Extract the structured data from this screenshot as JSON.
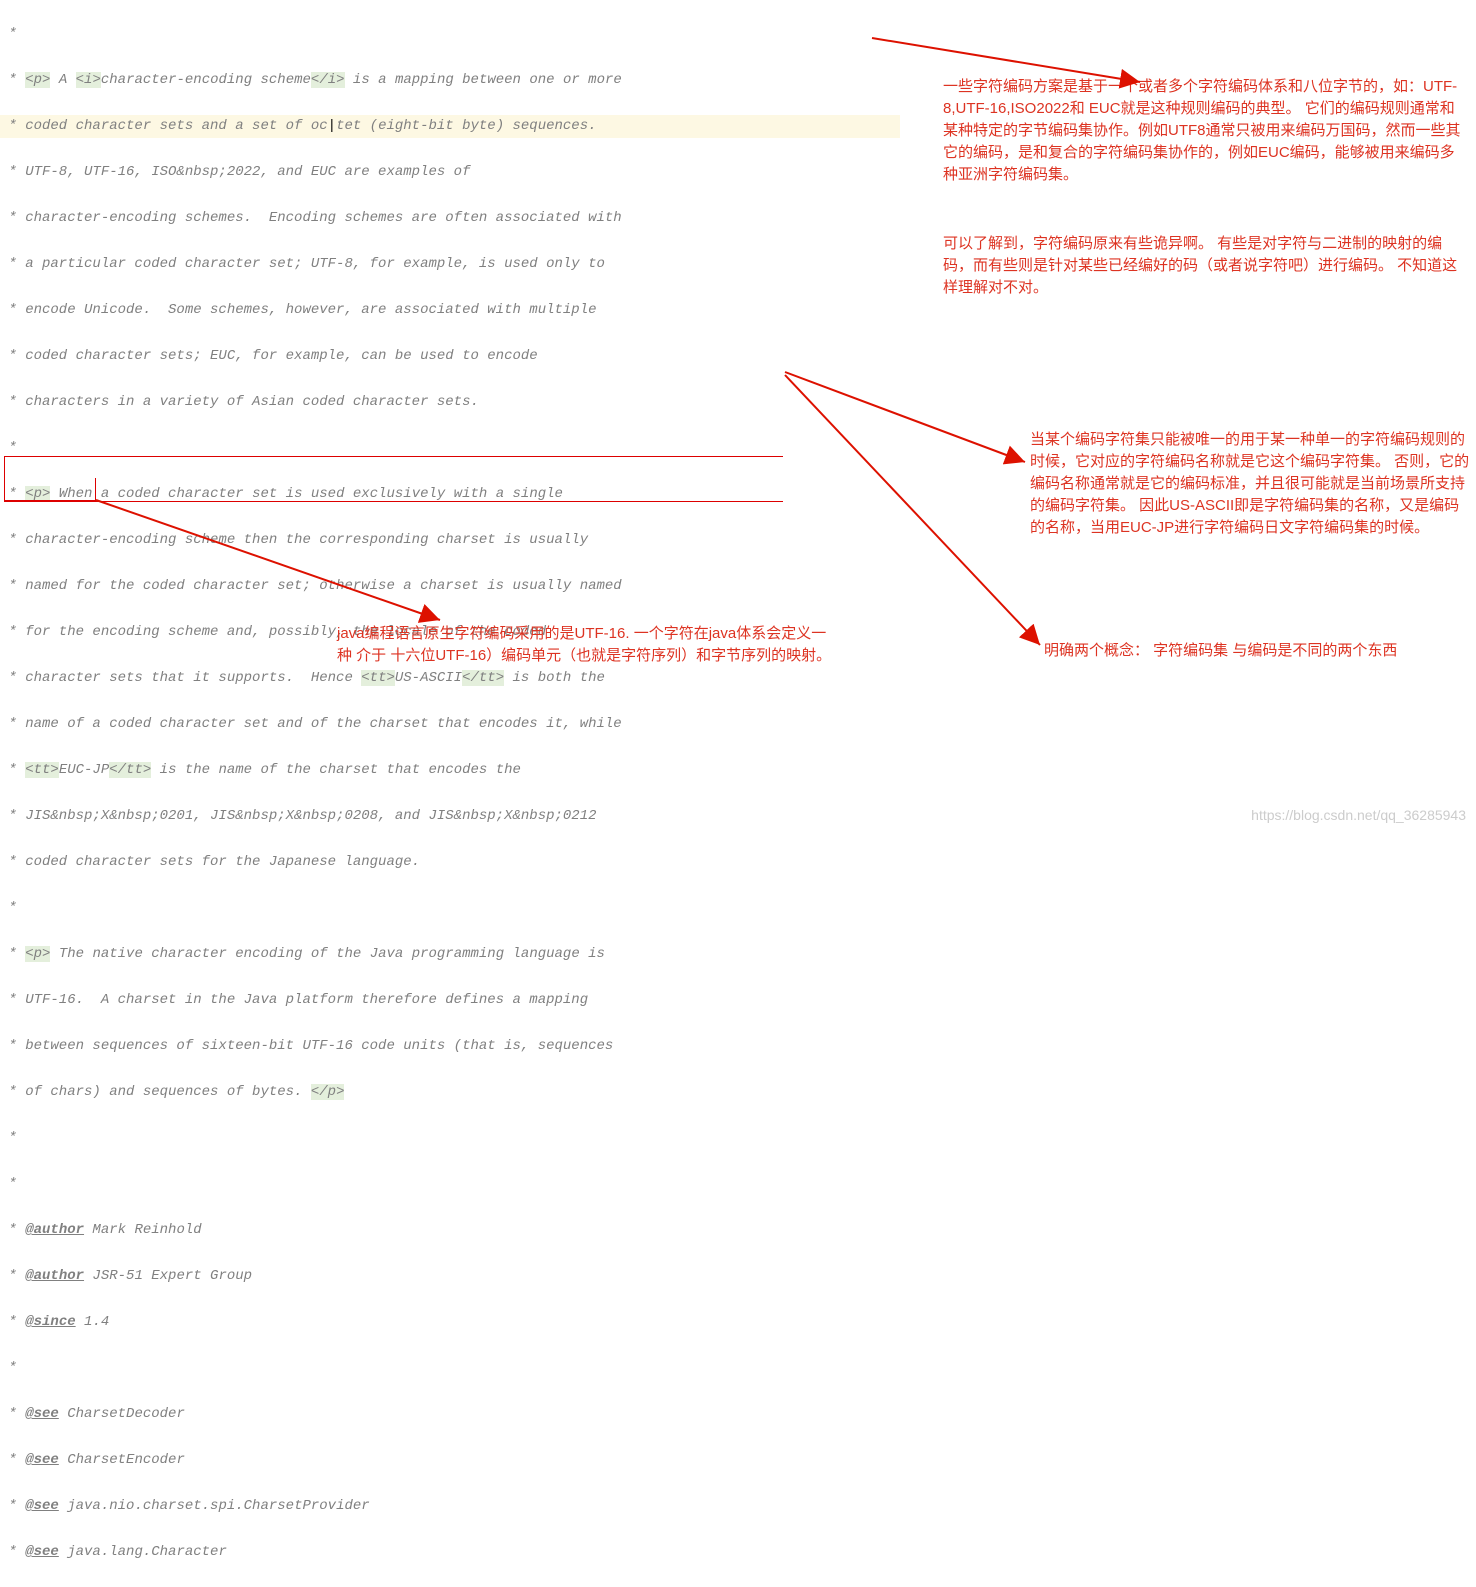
{
  "code": {
    "l0a": " *",
    "l1": " * <p> A <i>character-encoding scheme</i> is a mapping between one or more",
    "l1_pre": " * ",
    "l1_p": "<p>",
    "l1_mid1": " A ",
    "l1_i1": "<i>",
    "l1_mid2": "character-encoding scheme",
    "l1_i2": "</i>",
    "l1_post": " is a mapping between one or more",
    "l2_pre": " * coded character sets and a set of oc",
    "l2_cur": "|",
    "l2_post": "tet (eight-bit byte) sequences.",
    "l3": " * UTF-8, UTF-16, ISO&nbsp;2022, and EUC are examples of",
    "l4": " * character-encoding schemes.  Encoding schemes are often associated with",
    "l5": " * a particular coded character set; UTF-8, for example, is used only to",
    "l6": " * encode Unicode.  Some schemes, however, are associated with multiple",
    "l7": " * coded character sets; EUC, for example, can be used to encode",
    "l8": " * characters in a variety of Asian coded character sets.",
    "l9": " *",
    "l10_pre": " * ",
    "l10_p": "<p>",
    "l10_post": " When a coded character set is used exclusively with a single",
    "l11": " * character-encoding scheme then the corresponding charset is usually",
    "l12": " * named for the coded character set; otherwise a charset is usually named",
    "l13": " * for the encoding scheme and, possibly, the locale of the coded",
    "l14_pre": " * character sets that it supports.  Hence ",
    "l14_tt1": "<tt>",
    "l14_mid": "US-ASCII",
    "l14_tt2": "</tt>",
    "l14_post": " is both the",
    "l15": " * name of a coded character set and of the charset that encodes it, while",
    "l16_pre": " * ",
    "l16_tt1": "<tt>",
    "l16_mid": "EUC-JP",
    "l16_tt2": "</tt>",
    "l16_post": " is the name of the charset that encodes the",
    "l17": " * JIS&nbsp;X&nbsp;0201, JIS&nbsp;X&nbsp;0208, and JIS&nbsp;X&nbsp;0212",
    "l18": " * coded character sets for the Japanese language.",
    "l19": " *",
    "l20_pre": " * ",
    "l20_p": "<p>",
    "l20_post": " The native character encoding of the Java programming language is",
    "l21": " * UTF-16.  A charset in the Java platform therefore defines a mapping",
    "l22": " * between sequences of sixteen-bit UTF-16 code units (that is, sequences",
    "l23_pre": " * of chars) and sequences of bytes. ",
    "l23_p": "</p>",
    "l24": " *",
    "l25": " *",
    "l26_pre": " * ",
    "l26_tag": "@author",
    "l26_post": " Mark Reinhold",
    "l27_pre": " * ",
    "l27_tag": "@author",
    "l27_post": " JSR-51 Expert Group",
    "l28_pre": " * ",
    "l28_tag": "@since",
    "l28_post": " 1.4",
    "l29": " *",
    "l30_pre": " * ",
    "l30_tag": "@see",
    "l30_post": " CharsetDecoder",
    "l31_pre": " * ",
    "l31_tag": "@see",
    "l31_post": " CharsetEncoder",
    "l32_pre": " * ",
    "l32_tag": "@see",
    "l32_post": " java.nio.charset.spi.CharsetProvider",
    "l33_pre": " * ",
    "l33_tag": "@see",
    "l33_post": " java.lang.Character"
  },
  "annotations": {
    "a1": "一些字符编码方案是基于一个或者多个字符编码体系和八位字节的，如：UTF-8,UTF-16,ISO2022和 EUC就是这种规则编码的典型。 它们的编码规则通常和某种特定的字节编码集协作。例如UTF8通常只被用来编码万国码，然而一些其它的编码，是和复合的字符编码集协作的，例如EUC编码，能够被用来编码多种亚洲字符编码集。",
    "a2": "可以了解到，字符编码原来有些诡异啊。 有些是对字符与二进制的映射的编码，而有些则是针对某些已经编好的码（或者说字符吧）进行编码。   不知道这样理解对不对。",
    "a3": "当某个编码字符集只能被唯一的用于某一种单一的字符编码规则的时候，它对应的字符编码名称就是它这个编码字符集。 否则，它的编码名称通常就是它的编码标准，并且很可能就是当前场景所支持的编码字符集。 因此US-ASCII即是字符编码集的名称，又是编码的名称，当用EUC-JP进行字符编码日文字符编码集的时候。",
    "a4": "明确两个概念： 字符编码集 与编码是不同的两个东西",
    "a5": "java编程语言原生字符编码采用的是UTF-16.    一个字符在java体系会定义一种  介于  十六位UTF-16）编码单元（也就是字符序列）和字节序列的映射。"
  },
  "watermark": "https://blog.csdn.net/qq_36285943"
}
